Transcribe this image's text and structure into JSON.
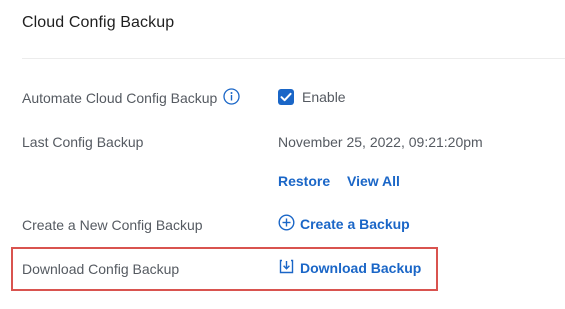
{
  "section": {
    "title": "Cloud Config Backup"
  },
  "automate": {
    "label": "Automate Cloud Config Backup",
    "info_icon": "info-icon",
    "enable_label": "Enable",
    "enable_checked": true
  },
  "last_backup": {
    "label": "Last Config Backup",
    "value": "November 25, 2022, 09:21:20pm",
    "restore_label": "Restore",
    "view_all_label": "View All"
  },
  "create_backup": {
    "label": "Create a New Config Backup",
    "action_label": "Create a Backup",
    "icon": "plus-circle-icon"
  },
  "download_backup": {
    "label": "Download Config Backup",
    "action_label": "Download Backup",
    "icon": "download-icon",
    "highlighted": true
  },
  "colors": {
    "accent": "#1a66c7",
    "highlight_border": "#d9534f",
    "label_text": "#555a61",
    "title_text": "#1f1f1f"
  }
}
